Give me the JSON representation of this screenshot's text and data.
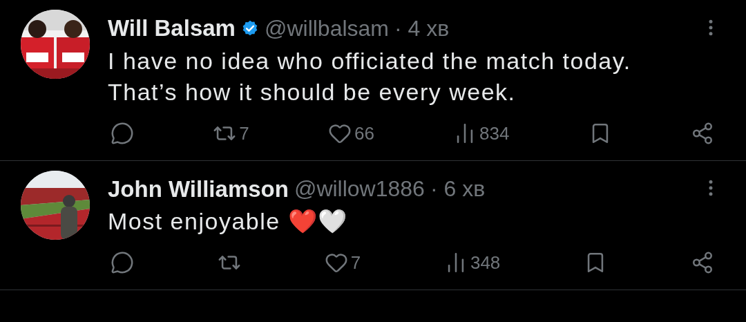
{
  "tweets": [
    {
      "author": "Will Balsam",
      "verified": true,
      "handle": "@willbalsam",
      "time": "· 4 хв",
      "text": "I have no idea who officiated the match today. That’s how it should be every week.",
      "actions": [
        {
          "kind": "reply"
        },
        {
          "kind": "repost",
          "count": "7"
        },
        {
          "kind": "like",
          "count": "66"
        },
        {
          "kind": "views",
          "count": "834"
        },
        {
          "kind": "bookmark"
        },
        {
          "kind": "share"
        }
      ]
    },
    {
      "author": "John Williamson",
      "verified": false,
      "handle": "@willow1886",
      "time": "· 6 хв",
      "text": "Most enjoyable ❤️🤍",
      "actions": [
        {
          "kind": "reply"
        },
        {
          "kind": "repost"
        },
        {
          "kind": "like",
          "count": "7"
        },
        {
          "kind": "views",
          "count": "348"
        },
        {
          "kind": "bookmark"
        },
        {
          "kind": "share"
        }
      ]
    }
  ]
}
